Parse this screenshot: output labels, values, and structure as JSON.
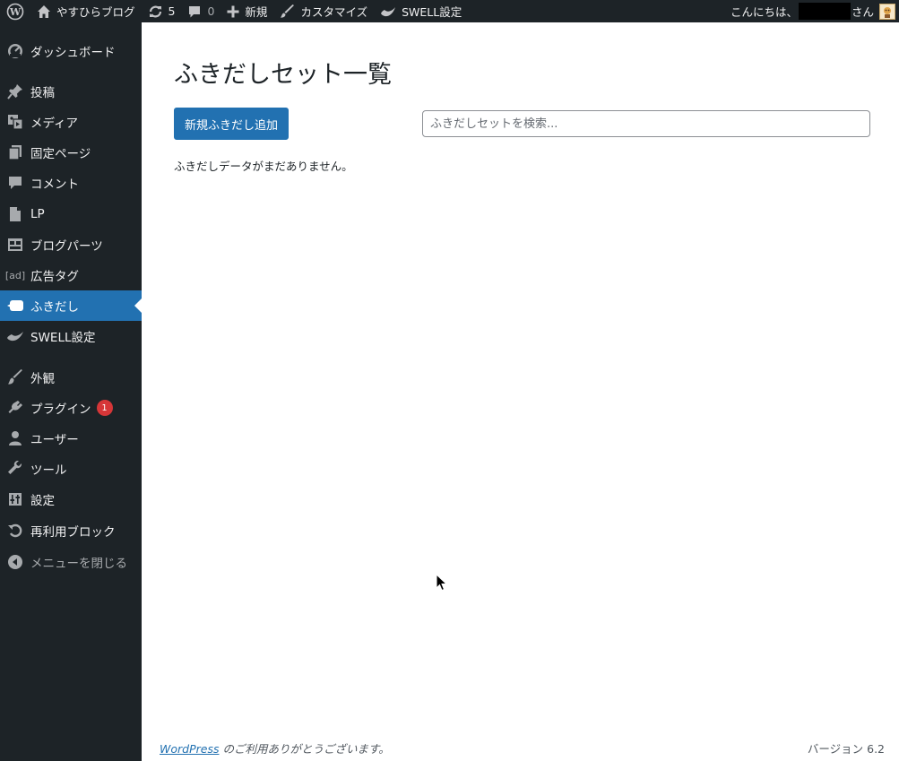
{
  "admin_bar": {
    "site_name": "やすひらブログ",
    "updates_count": "5",
    "comments_count": "0",
    "new_label": "新規",
    "customize_label": "カスタマイズ",
    "swell_label": "SWELL設定",
    "greeting_prefix": "こんにちは、",
    "greeting_suffix": "さん",
    "icons": [
      "wordpress-logo-icon",
      "home-icon",
      "updates-icon",
      "comment-icon",
      "plus-icon",
      "brush-icon",
      "swell-icon",
      "avatar"
    ]
  },
  "sidebar": {
    "items": [
      {
        "label": "ダッシュボード",
        "icon": "dashboard-icon"
      },
      {
        "label": "投稿",
        "icon": "pin-icon"
      },
      {
        "label": "メディア",
        "icon": "media-icon"
      },
      {
        "label": "固定ページ",
        "icon": "pages-icon"
      },
      {
        "label": "コメント",
        "icon": "comment-icon"
      },
      {
        "label": "LP",
        "icon": "document-icon"
      },
      {
        "label": "ブログパーツ",
        "icon": "layout-icon"
      },
      {
        "label": "広告タグ",
        "icon": "ad-icon",
        "icon_text": "[ad]"
      },
      {
        "label": "ふきだし",
        "icon": "speech-bubble-icon",
        "current": true
      },
      {
        "label": "SWELL設定",
        "icon": "swell-icon"
      },
      {
        "label": "外観",
        "icon": "appearance-icon"
      },
      {
        "label": "プラグイン",
        "icon": "plugin-icon",
        "badge": "1"
      },
      {
        "label": "ユーザー",
        "icon": "user-icon"
      },
      {
        "label": "ツール",
        "icon": "wrench-icon"
      },
      {
        "label": "設定",
        "icon": "settings-icon"
      },
      {
        "label": "再利用ブロック",
        "icon": "reusable-icon"
      },
      {
        "label": "メニューを閉じる",
        "icon": "collapse-icon"
      }
    ]
  },
  "main": {
    "title": "ふきだしセット一覧",
    "add_button_label": "新規ふきだし追加",
    "search_placeholder": "ふきだしセットを検索...",
    "empty_message": "ふきだしデータがまだありません。"
  },
  "footer": {
    "wordpress_link": "WordPress",
    "thanks_text": " のご利用ありがとうございます。",
    "version": "バージョン 6.2"
  },
  "colors": {
    "admin_dark": "#1d2327",
    "accent_blue": "#2271b1",
    "badge_red": "#d63638"
  }
}
